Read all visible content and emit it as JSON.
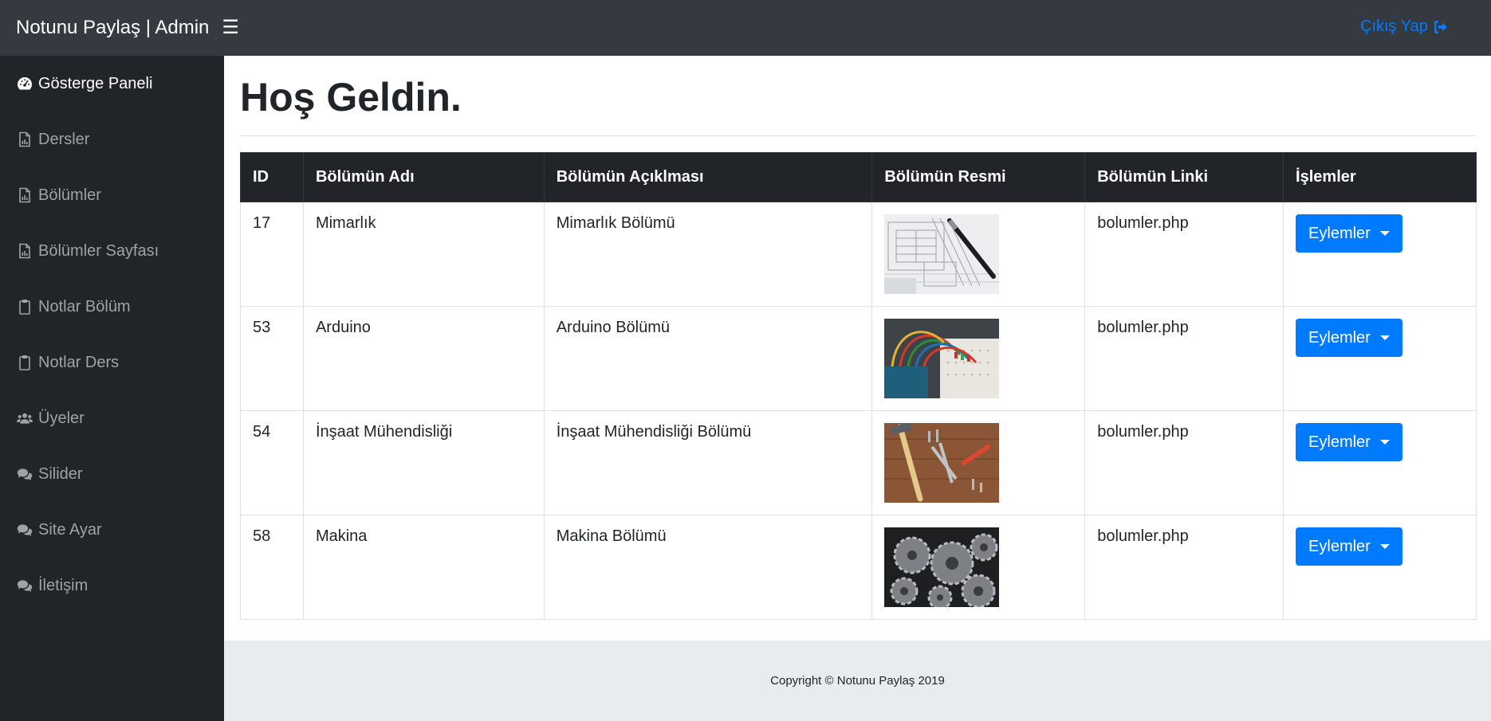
{
  "header": {
    "brand": "Notunu Paylaş | Admin",
    "toggle_icon": "menu-icon",
    "logout_label": "Çıkış Yap",
    "logout_icon": "sign-out-icon",
    "logout_color": "#007bff"
  },
  "sidebar": {
    "items": [
      {
        "label": "Gösterge Paneli",
        "icon": "tachometer-icon",
        "active": true
      },
      {
        "label": "Dersler",
        "icon": "file-chart-icon"
      },
      {
        "label": "Bölümler",
        "icon": "file-chart-icon"
      },
      {
        "label": "Bölümler Sayfası",
        "icon": "file-chart-icon"
      },
      {
        "label": "Notlar Bölüm",
        "icon": "clipboard-icon"
      },
      {
        "label": "Notlar Ders",
        "icon": "clipboard-icon"
      },
      {
        "label": "Üyeler",
        "icon": "users-icon"
      },
      {
        "label": "Silider",
        "icon": "comments-icon"
      },
      {
        "label": "Site Ayar",
        "icon": "comments-icon"
      },
      {
        "label": "İletişim",
        "icon": "comments-icon"
      }
    ]
  },
  "main": {
    "title": "Hoş Geldin.",
    "table": {
      "columns": [
        "ID",
        "Bölümün Adı",
        "Bölümün Açıklması",
        "Bölümün Resmi",
        "Bölümün Linki",
        "İşlemler"
      ],
      "rows": [
        {
          "id": "17",
          "name": "Mimarlık",
          "description": "Mimarlık Bölümü",
          "image": "architecture-drawing-image",
          "link": "bolumler.php",
          "action": "Eylemler"
        },
        {
          "id": "53",
          "name": "Arduino",
          "description": "Arduino Bölümü",
          "image": "breadboard-circuit-image",
          "link": "bolumler.php",
          "action": "Eylemler"
        },
        {
          "id": "54",
          "name": "İnşaat Mühendisliği",
          "description": "İnşaat Mühendisliği Bölümü",
          "image": "tools-on-wood-image",
          "link": "bolumler.php",
          "action": "Eylemler"
        },
        {
          "id": "58",
          "name": "Makina",
          "description": "Makina Bölümü",
          "image": "gears-image",
          "link": "bolumler.php",
          "action": "Eylemler"
        }
      ]
    }
  },
  "footer": {
    "text": "Copyright © Notunu Paylaş 2019"
  },
  "colors": {
    "topbar": "#343a40",
    "sidebar": "#212529",
    "primary": "#007bff",
    "footer_bg": "#e9ecef"
  }
}
